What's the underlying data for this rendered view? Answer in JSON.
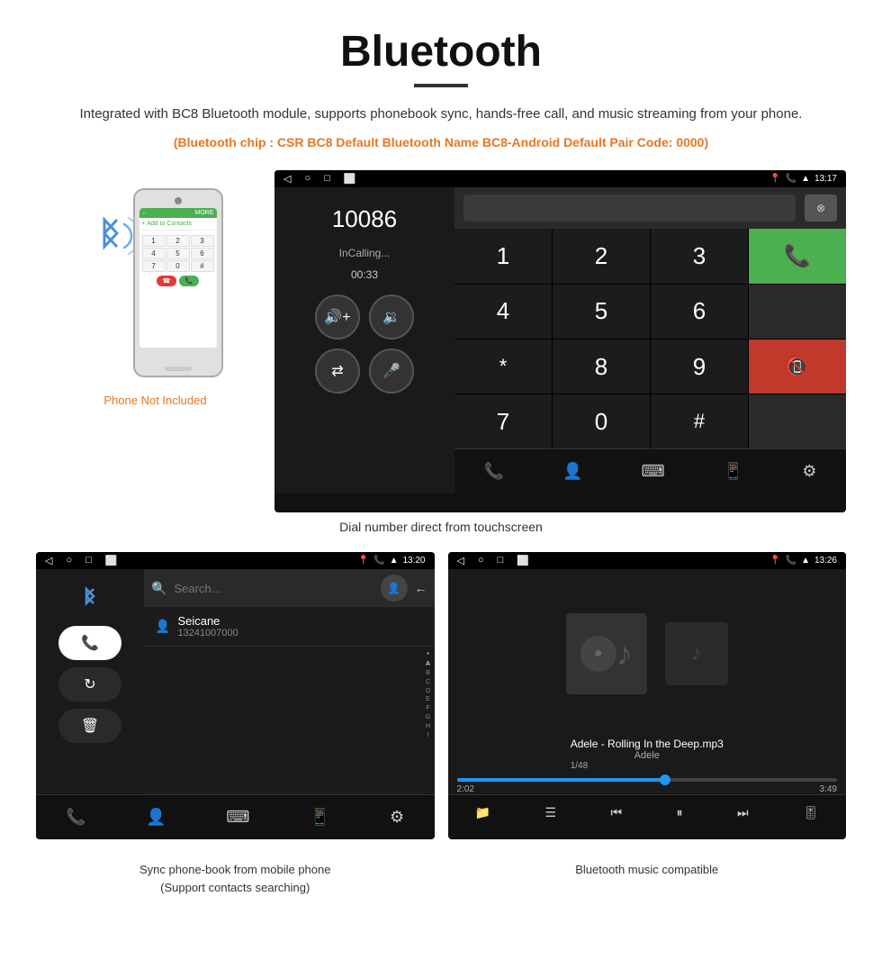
{
  "header": {
    "title": "Bluetooth",
    "description": "Integrated with BC8 Bluetooth module, supports phonebook sync, hands-free call, and music streaming from your phone.",
    "bluetooth_info": "(Bluetooth chip : CSR BC8    Default Bluetooth Name BC8-Android    Default Pair Code: 0000)"
  },
  "phone_label": "Phone Not Included",
  "dialer": {
    "status_nav": "◁  ○  □",
    "status_right": "13:17",
    "number": "10086",
    "call_status": "InCalling...",
    "call_timer": "00:33",
    "keys": [
      "1",
      "2",
      "3",
      "*",
      "4",
      "5",
      "6",
      "0",
      "7",
      "8",
      "9",
      "#"
    ],
    "caption": "Dial number direct from touchscreen"
  },
  "phonebook": {
    "status_right": "13:20",
    "contact_name": "Seicane",
    "contact_number": "13241007000",
    "alphabet": [
      "*",
      "A",
      "B",
      "C",
      "D",
      "E",
      "F",
      "G",
      "H",
      "I"
    ],
    "caption_line1": "Sync phone-book from mobile phone",
    "caption_line2": "(Support contacts searching)"
  },
  "music": {
    "status_right": "13:26",
    "song_title": "Adele - Rolling In the Deep.mp3",
    "artist": "Adele",
    "track_info": "1/48",
    "time_current": "2:02",
    "time_total": "3:49",
    "caption": "Bluetooth music compatible"
  },
  "icons": {
    "bluetooth": "✱",
    "phone_call": "📞",
    "volume_up": "🔊",
    "volume_down": "🔉",
    "mic": "🎤",
    "transfer": "⇄",
    "backspace": "⌫",
    "search": "🔍",
    "contacts": "👤",
    "dialpad": "⌨",
    "device": "📱",
    "settings": "⚙",
    "shuffle": "⇌",
    "folder": "📁",
    "list": "☰",
    "prev": "⏮",
    "play": "⏸",
    "next": "⏭",
    "equalizer": "🎚"
  }
}
